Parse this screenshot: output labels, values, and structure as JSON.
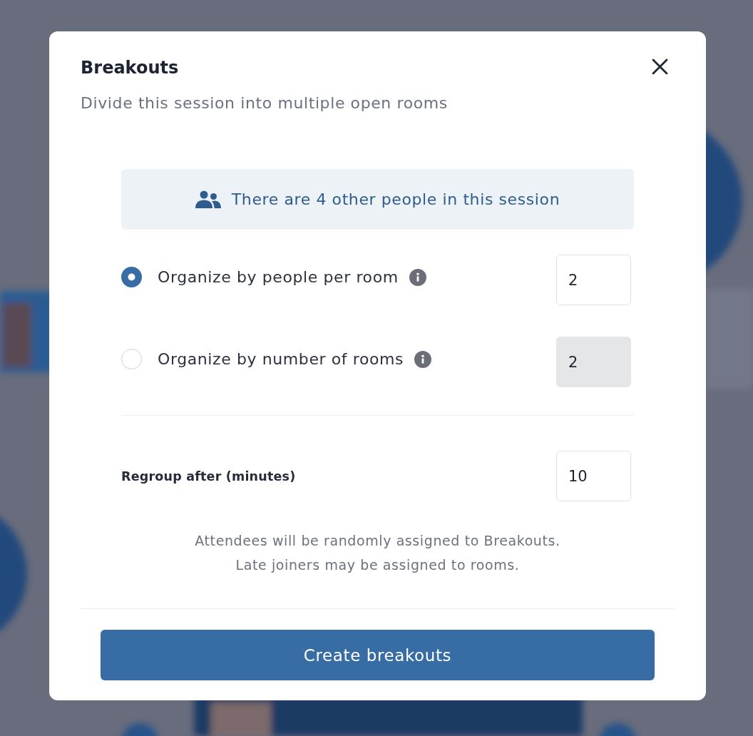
{
  "dialog": {
    "title": "Breakouts",
    "subtitle": "Divide this session into multiple open rooms"
  },
  "banner": {
    "text": "There are 4 other people in this session"
  },
  "options": [
    {
      "label": "Organize by people per room",
      "selected": true,
      "value": "2",
      "disabled": false
    },
    {
      "label": "Organize by number of rooms",
      "selected": false,
      "value": "2",
      "disabled": true
    }
  ],
  "regroup": {
    "label": "Regroup after (minutes)",
    "value": "10"
  },
  "note": [
    "Attendees will be randomly assigned to Breakouts.",
    "Late joiners may be assigned to rooms."
  ],
  "primary_button": {
    "label": "Create breakouts"
  }
}
